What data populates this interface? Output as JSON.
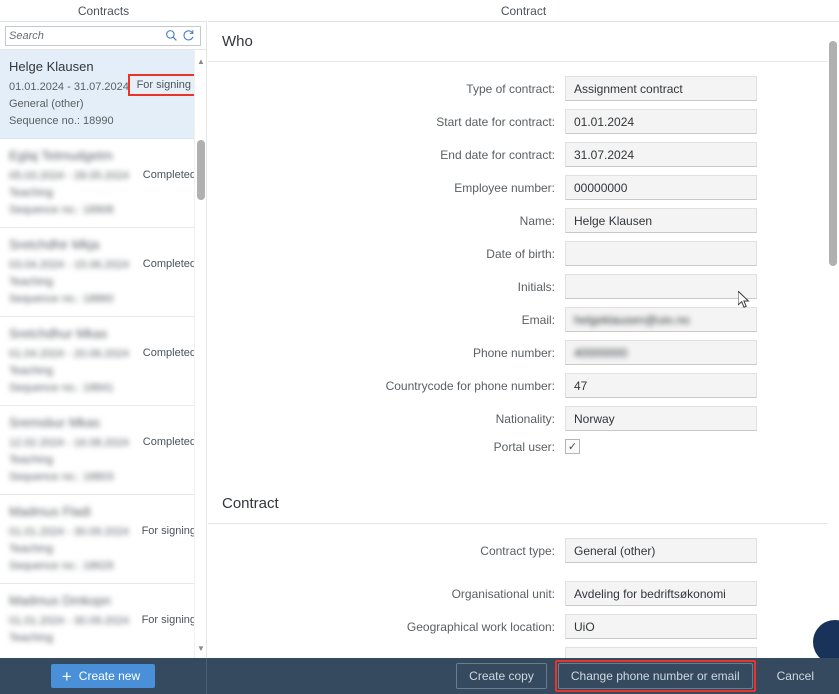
{
  "headers": {
    "left_title": "Contracts",
    "right_title": "Contract"
  },
  "search": {
    "placeholder": "Search",
    "value": "",
    "search_icon": "search-icon",
    "refresh_icon": "refresh-icon"
  },
  "contract_list": [
    {
      "name": "Helge Klausen",
      "dates": "01.01.2024 - 31.07.2024",
      "type": "General (other)",
      "sequence": "Sequence no.: 18990",
      "status": "For signing",
      "selected": true,
      "redacted": false,
      "highlighted": true
    },
    {
      "name": "Eglaj Tetmudgetm",
      "dates": "05.03.2024 - 28.05.2024",
      "type": "Teaching",
      "sequence": "Sequence no.: 18908",
      "status": "Completed",
      "selected": false,
      "redacted": true,
      "highlighted": false
    },
    {
      "name": "Sretchdhir Mkja",
      "dates": "03.04.2024 - 15.06.2024",
      "type": "Teaching",
      "sequence": "Sequence no.: 18860",
      "status": "Completed",
      "selected": false,
      "redacted": true,
      "highlighted": false
    },
    {
      "name": "Sretchdhur Mkas",
      "dates": "01.04.2024 - 20.06.2024",
      "type": "Teaching",
      "sequence": "Sequence no.: 18841",
      "status": "Completed",
      "selected": false,
      "redacted": true,
      "highlighted": false
    },
    {
      "name": "Sremsbur Mkas",
      "dates": "12.02.2024 - 16.08.2024",
      "type": "Teaching",
      "sequence": "Sequence no.: 18803",
      "status": "Completed",
      "selected": false,
      "redacted": true,
      "highlighted": false
    },
    {
      "name": "Madmus Fladi",
      "dates": "01.01.2024 - 30.09.2024",
      "type": "Teaching",
      "sequence": "Sequence no.: 18629",
      "status": "For signing",
      "selected": false,
      "redacted": true,
      "highlighted": false
    },
    {
      "name": "Madmus Dmkopn",
      "dates": "01.01.2024 - 30.09.2024",
      "type": "Teaching",
      "sequence": "",
      "status": "For signing",
      "selected": false,
      "redacted": true,
      "highlighted": false
    }
  ],
  "form": {
    "section_who": "Who",
    "section_contract": "Contract",
    "who_fields": [
      {
        "label": "Type of contract:",
        "value": "Assignment contract",
        "redacted": false,
        "type": "text"
      },
      {
        "label": "Start date for contract:",
        "value": "01.01.2024",
        "redacted": false,
        "type": "text"
      },
      {
        "label": "End date for contract:",
        "value": "31.07.2024",
        "redacted": false,
        "type": "text"
      },
      {
        "label": "Employee number:",
        "value": "00000000",
        "redacted": false,
        "type": "text"
      },
      {
        "label": "Name:",
        "value": "Helge Klausen",
        "redacted": false,
        "type": "text"
      },
      {
        "label": "Date of birth:",
        "value": "",
        "redacted": false,
        "type": "text"
      },
      {
        "label": "Initials:",
        "value": "",
        "redacted": false,
        "type": "text"
      },
      {
        "label": "Email:",
        "value": "helgeklausen@uio.no",
        "redacted": true,
        "type": "text"
      },
      {
        "label": "Phone number:",
        "value": "40000000",
        "redacted": true,
        "type": "text"
      },
      {
        "label": "Countrycode for phone number:",
        "value": "47",
        "redacted": false,
        "type": "text"
      },
      {
        "label": "Nationality:",
        "value": "Norway",
        "redacted": false,
        "type": "text"
      },
      {
        "label": "Portal user:",
        "value": "✓",
        "redacted": false,
        "type": "checkbox"
      }
    ],
    "contract_fields": [
      {
        "label": "Contract type:",
        "value": "General (other)",
        "redacted": false,
        "type": "text"
      },
      {
        "label": "Organisational unit:",
        "value": "Avdeling for bedriftsøkonomi",
        "redacted": false,
        "type": "text"
      },
      {
        "label": "Geographical work location:",
        "value": "UiO",
        "redacted": false,
        "type": "text"
      },
      {
        "label": "",
        "value": "",
        "redacted": true,
        "type": "text"
      }
    ]
  },
  "toolbar": {
    "create_new": "Create new",
    "create_copy": "Create copy",
    "change_phone_email": "Change phone number or email",
    "cancel": "Cancel"
  },
  "colors": {
    "accent_blue": "#4a90d9",
    "toolbar_bg": "#354a5f",
    "selected_row": "#e3eef9",
    "annotation_red": "#e8342a"
  }
}
